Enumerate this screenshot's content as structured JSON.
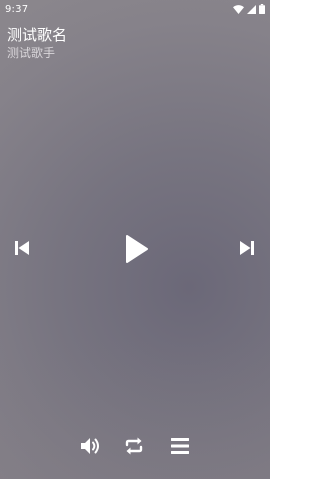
{
  "status_bar": {
    "time": "9:37",
    "icons": [
      "wifi-icon",
      "signal-icon",
      "battery-icon"
    ]
  },
  "song": {
    "title": "测试歌名",
    "artist": "测试歌手"
  },
  "controls": {
    "previous": "skip-previous-icon",
    "play": "play-icon",
    "next": "skip-next-icon",
    "volume": "volume-icon",
    "repeat": "repeat-icon",
    "playlist": "playlist-icon"
  },
  "colors": {
    "icon": "#ffffff",
    "artist_text": "#d9d6da",
    "background": "#7a7682"
  }
}
